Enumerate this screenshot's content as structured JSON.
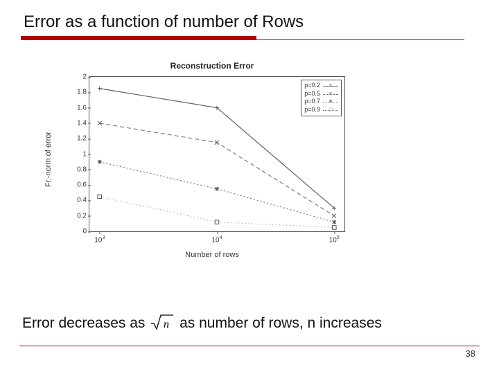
{
  "title": "Error as a function of number of Rows",
  "caption": {
    "before": "Error decreases as ",
    "sqrt_arg": "n",
    "after": " as number of rows, n increases"
  },
  "page_number": "38",
  "chart_data": {
    "type": "line",
    "title": "Reconstruction Error",
    "xlabel": "Number of rows",
    "ylabel": "Fr.-norm of error",
    "xscale": "log",
    "x": [
      1000,
      10000,
      100000
    ],
    "xtick_labels": [
      "10^3",
      "10^4",
      "10^5"
    ],
    "ylim": [
      0,
      2
    ],
    "yticks": [
      0,
      0.2,
      0.4,
      0.6,
      0.8,
      1,
      1.2,
      1.4,
      1.6,
      1.8,
      2
    ],
    "series": [
      {
        "name": "p=0.2",
        "marker": "+",
        "style": "solid",
        "values": [
          1.85,
          1.6,
          0.3
        ]
      },
      {
        "name": "p=0.5",
        "marker": "x",
        "style": "dashed",
        "values": [
          1.4,
          1.15,
          0.2
        ]
      },
      {
        "name": "p=0.7",
        "marker": "*",
        "style": "dotted",
        "values": [
          0.9,
          0.55,
          0.12
        ]
      },
      {
        "name": "p=0.9",
        "marker": "□",
        "style": "dotted",
        "values": [
          0.45,
          0.12,
          0.05
        ]
      }
    ]
  }
}
